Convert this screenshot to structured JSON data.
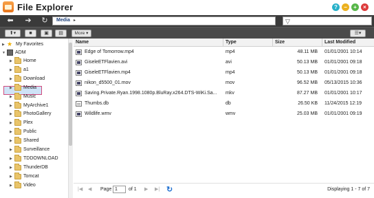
{
  "window": {
    "title": "File Explorer",
    "buttons": {
      "help": "?",
      "minimize": "−",
      "maximize": "+",
      "close": "×"
    }
  },
  "address": {
    "path": "Media",
    "separator": "▸",
    "back_icon": "arrow-left-icon",
    "forward_icon": "arrow-right-icon",
    "refresh_icon": "refresh-icon",
    "filter_icon": "filter-icon"
  },
  "toolbar": {
    "more_label": "More ▾"
  },
  "tree": {
    "favorites_label": "My Favorites",
    "root_label": "ADM",
    "folders": [
      "Home",
      "a1",
      "Download",
      "Media",
      "Music",
      "MyArchive1",
      "PhotoGallery",
      "Plex",
      "Public",
      "Shared",
      "Surveillance",
      "TDDOWNLOAD",
      "ThunderDB",
      "Tomcat",
      "Video"
    ],
    "selected": "Media"
  },
  "table": {
    "columns": [
      "Name",
      "Type",
      "Size",
      "Last Modified"
    ],
    "rows": [
      {
        "name": "Edge of Tomorrow.mp4",
        "type": "mp4",
        "size": "48.11 MB",
        "modified": "01/01/2001 10:14",
        "icon": "video"
      },
      {
        "name": "GiseleETFlavien.avi",
        "type": "avi",
        "size": "50.13 MB",
        "modified": "01/01/2001 09:18",
        "icon": "video"
      },
      {
        "name": "GiseleETFlavien.mp4",
        "type": "mp4",
        "size": "50.13 MB",
        "modified": "01/01/2001 09:18",
        "icon": "video"
      },
      {
        "name": "nikon_d5500_01.mov",
        "type": "mov",
        "size": "96.52 MB",
        "modified": "05/13/2015 10:36",
        "icon": "video"
      },
      {
        "name": "Saving.Private.Ryan.1998.1080p.BluRay.x264.DTS-WiKi.Sa...",
        "type": "mkv",
        "size": "87.27 MB",
        "modified": "01/01/2001 10:17",
        "icon": "video"
      },
      {
        "name": "Thumbs.db",
        "type": "db",
        "size": "26.50 KB",
        "modified": "11/24/2015 12:19",
        "icon": "doc"
      },
      {
        "name": "Wildlife.wmv",
        "type": "wmv",
        "size": "25.03 MB",
        "modified": "01/01/2001 09:19",
        "icon": "video"
      }
    ]
  },
  "pager": {
    "page_label": "Page",
    "page_value": "1",
    "of_label": "of 1",
    "display_text": "Displaying 1 - 7 of 7"
  }
}
